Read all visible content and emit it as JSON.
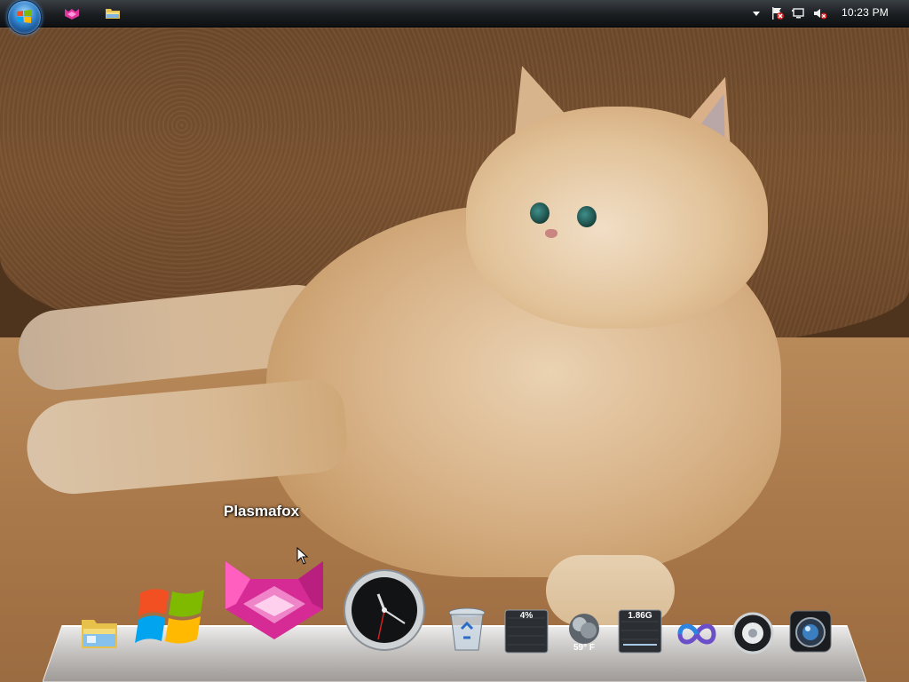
{
  "taskbar": {
    "start_button_name": "Start",
    "pinned": [
      {
        "name": "Plasmafox",
        "icon": "plasmafox-icon"
      },
      {
        "name": "Windows Explorer",
        "icon": "folder-icon"
      }
    ],
    "tray": {
      "icons": [
        "show-hidden-icons-arrow",
        "action-center-flag-icon",
        "network-icon",
        "volume-muted-icon"
      ],
      "clock": "10:23 PM"
    }
  },
  "dock": {
    "hover_label": "Plasmafox",
    "items": [
      {
        "name": "Windows Explorer",
        "icon": "folder-icon"
      },
      {
        "name": "Windows",
        "icon": "windows-logo-icon"
      },
      {
        "name": "Plasmafox",
        "icon": "plasmafox-icon"
      },
      {
        "name": "Clock",
        "icon": "clock-icon"
      },
      {
        "name": "Recycle Bin",
        "icon": "recycle-bin-icon"
      },
      {
        "name": "CPU meter",
        "icon": "cpu-meter-icon",
        "value": "4%"
      },
      {
        "name": "Weather",
        "icon": "weather-icon",
        "value": "59° F"
      },
      {
        "name": "Memory meter",
        "icon": "memory-meter-icon",
        "value": "1.86G"
      },
      {
        "name": "Visual Studio",
        "icon": "infinity-icon"
      },
      {
        "name": "Media player",
        "icon": "speaker-icon"
      },
      {
        "name": "Camera",
        "icon": "camera-icon"
      }
    ]
  },
  "colors": {
    "taskbar_bg": "#1b1e21",
    "start_orb": "#2f7fc9",
    "plasmafox_pink": "#e0349f",
    "dock_glass": "#d8dde2"
  }
}
